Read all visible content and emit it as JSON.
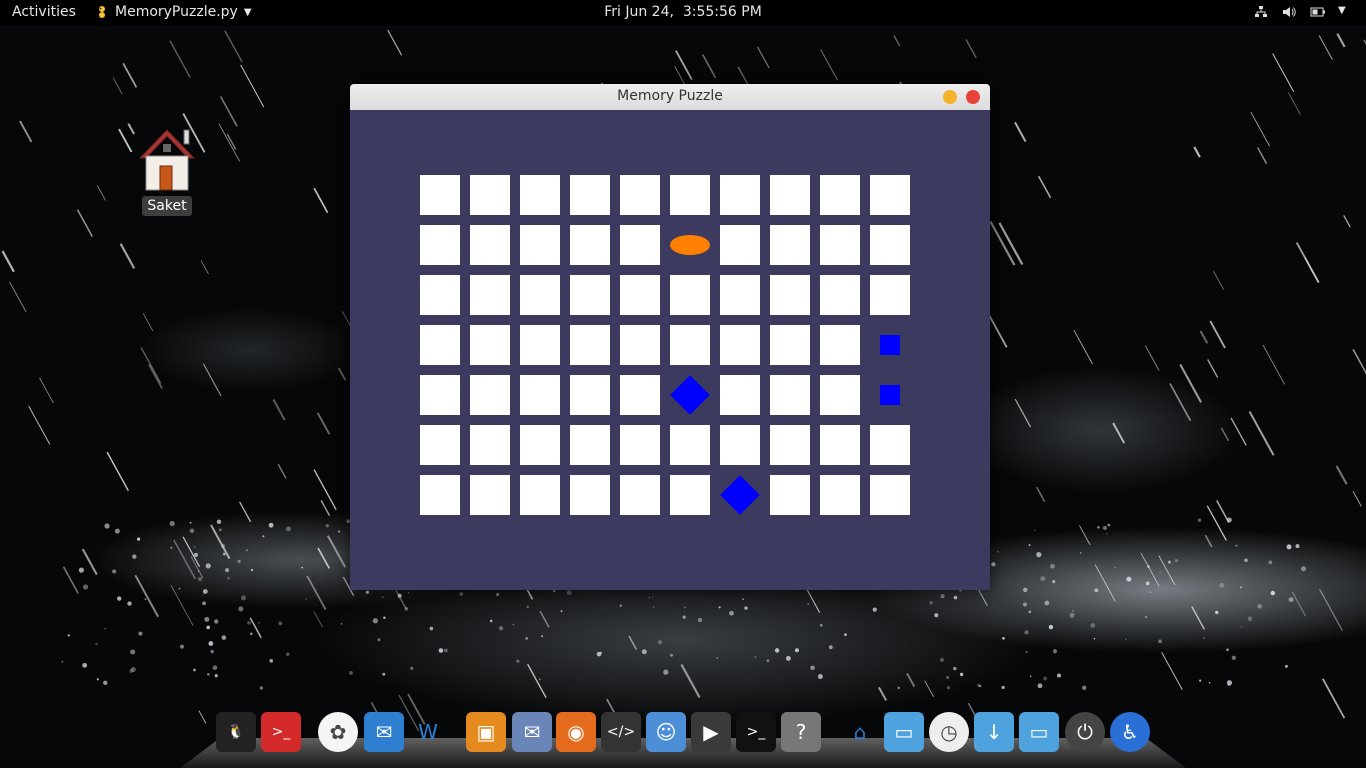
{
  "topbar": {
    "activities_label": "Activities",
    "app_menu_label": "MemoryPuzzle.py",
    "clock": "Fri Jun 24,  3:55:56 PM",
    "tray_icons": [
      "network-icon",
      "volume-icon",
      "battery-icon",
      "system-menu-chevron-icon"
    ]
  },
  "desktop": {
    "home_icon_label": "Saket"
  },
  "window": {
    "title": "Memory Puzzle",
    "bg_color": "#3c3a5f",
    "board": {
      "columns": 10,
      "rows": 7,
      "covered_color": "#ffffff",
      "revealed": [
        {
          "row": 1,
          "col": 5,
          "shape": "oval",
          "color": "#ff8000"
        },
        {
          "row": 3,
          "col": 9,
          "shape": "square",
          "color": "#0000ff"
        },
        {
          "row": 4,
          "col": 5,
          "shape": "diamond",
          "color": "#0000ff"
        },
        {
          "row": 4,
          "col": 9,
          "shape": "square",
          "color": "#0000ff"
        },
        {
          "row": 6,
          "col": 6,
          "shape": "diamond",
          "color": "#0000ff"
        }
      ]
    }
  },
  "dock": {
    "items": [
      "tux-icon",
      "terminal-red-icon",
      "photos-icon",
      "mail-icon",
      "writer-icon",
      "package-icon",
      "mail-stamp-icon",
      "firefox-icon",
      "code-editor-icon",
      "finder-icon",
      "video-icon",
      "terminal-icon",
      "help-icon",
      "home-icon",
      "folder-icon",
      "clock-icon",
      "downloads-folder-icon",
      "folder-2-icon",
      "power-icon",
      "accessibility-icon"
    ]
  }
}
